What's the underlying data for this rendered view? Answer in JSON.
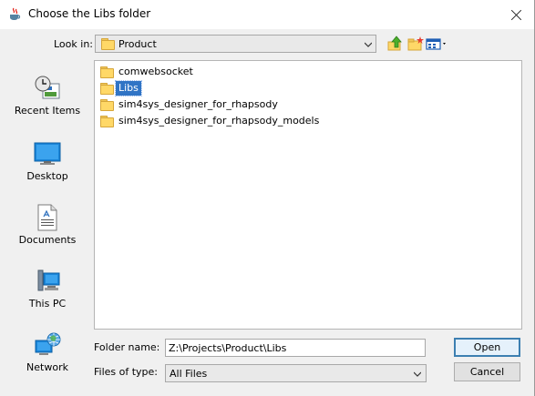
{
  "window": {
    "title": "Choose the Libs folder"
  },
  "toolbar": {
    "look_in_label": "Look in:",
    "look_in_value": "Product",
    "icons": [
      "up-one-level-icon",
      "create-new-folder-icon",
      "view-menu-icon"
    ]
  },
  "places": [
    {
      "label": "Recent Items",
      "icon": "recent-items-icon"
    },
    {
      "label": "Desktop",
      "icon": "desktop-icon"
    },
    {
      "label": "Documents",
      "icon": "documents-icon"
    },
    {
      "label": "This PC",
      "icon": "this-pc-icon"
    },
    {
      "label": "Network",
      "icon": "network-icon"
    }
  ],
  "files": [
    {
      "name": "comwebsocket",
      "selected": false
    },
    {
      "name": "Libs",
      "selected": true
    },
    {
      "name": "sim4sys_designer_for_rhapsody",
      "selected": false
    },
    {
      "name": "sim4sys_designer_for_rhapsody_models",
      "selected": false
    }
  ],
  "folder_name": {
    "label": "Folder name:",
    "value": "Z:\\Projects\\Product\\Libs"
  },
  "files_of_type": {
    "label": "Files of type:",
    "value": "All Files"
  },
  "buttons": {
    "open": "Open",
    "cancel": "Cancel"
  },
  "colors": {
    "selection": "#3074c5",
    "folder": "#ffd867",
    "accent_border": "#3c7fb1"
  }
}
